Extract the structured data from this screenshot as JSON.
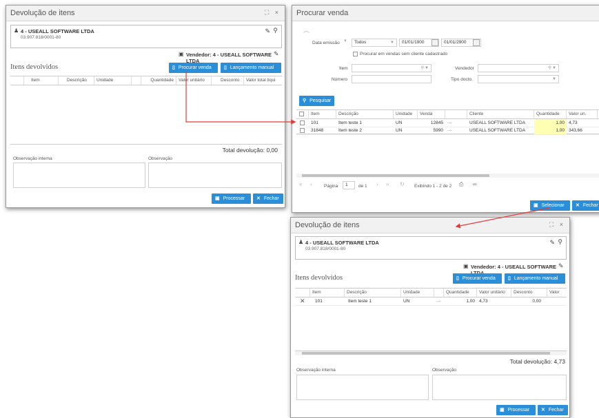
{
  "colors": {
    "accent": "#2a8fd8",
    "highlight": "#ffffb3",
    "arrow": "#e53935"
  },
  "win1": {
    "title": "Devolução de itens",
    "controls": "⛶ ×",
    "client_name": "4 - USEALL SOFTWARE LTDA",
    "client_doc": "03.907.818/0001-80",
    "vendor": "Vendedor: 4 - USEALL SOFTWARE LTDA",
    "section": "Itens devolvidos",
    "btn_search": "Procurar venda",
    "btn_manual": "Lançamento manual",
    "columns": [
      "",
      "Item",
      "Descrição",
      "Unidade",
      "",
      "Quantidade",
      "Valor unitário",
      "Desconto",
      "Valor total líqui"
    ],
    "total": "Total devolução: 0,00",
    "obs_internal": "Observação interna",
    "obs": "Observação",
    "btn_process": "Processar",
    "btn_close": "Fechar"
  },
  "win2": {
    "title": "Procurar venda",
    "date_label": "Data emissão",
    "date_option": "Todos",
    "date_from": "01/01/1900",
    "date_to": "01/01/2900",
    "no_client_check": "Procurar em vendas sem cliente cadastrado",
    "item_label": "Item",
    "number_label": "Número",
    "seller_label": "Vendedor",
    "doc_type_label": "Tipo docto.",
    "btn_search": "Pesquisar",
    "columns": [
      "",
      "Item",
      "Descrição",
      "Unidade",
      "Venda",
      "",
      "Cliente",
      "Quantidade",
      "Valor un."
    ],
    "rows": [
      {
        "item": "101",
        "desc": "Item teste 1",
        "unit": "UN",
        "sale": "12845",
        "more": "···",
        "client": "USEALL SOFTWARE LTDA",
        "qty": "1,00",
        "price": "4,73"
      },
      {
        "item": "31848",
        "desc": "Item teste 2",
        "unit": "UN",
        "sale": "5990",
        "more": "···",
        "client": "USEALL SOFTWARE LTDA",
        "qty": "1,00",
        "price": "343,66"
      }
    ],
    "pager_page": "Página",
    "pager_value": "1",
    "pager_of": "de 1",
    "pager_info": "Exibindo 1 - 2 de 2",
    "btn_select": "Selecionar",
    "btn_close": "Fechar"
  },
  "win3": {
    "title": "Devolução de itens",
    "controls": "⛶ ×",
    "client_name": "4 - USEALL SOFTWARE LTDA",
    "client_doc": "03.907.818/0001-80",
    "vendor": "Vendedor: 4 - USEALL SOFTWARE LTDA",
    "section": "Itens devolvidos",
    "btn_search": "Procurar venda",
    "btn_manual": "Lançamento manual",
    "columns": [
      "",
      "Item",
      "Descrição",
      "Unidade",
      "",
      "Quantidade",
      "Valor unitário",
      "Desconto",
      "Valor"
    ],
    "row": {
      "remove": "✕",
      "item": "101",
      "desc": "Item teste 1",
      "unit": "UN",
      "more": "···",
      "qty": "1,00",
      "price": "4,73",
      "discount": "0,00"
    },
    "total": "Total devolução: 4,73",
    "obs_internal": "Observação interna",
    "obs": "Observação",
    "btn_process": "Processar",
    "btn_close": "Fechar"
  }
}
